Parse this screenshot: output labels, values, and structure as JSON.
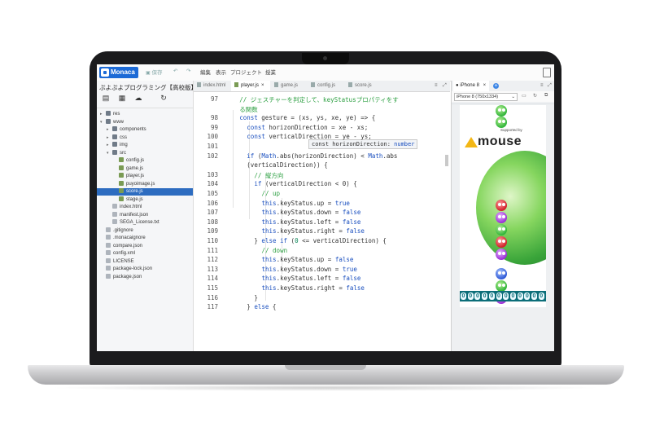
{
  "app": {
    "name": "Monaca",
    "brand_color": "#1c6ad6"
  },
  "toolbar": {
    "save": "保存",
    "undo_icon": "undo-icon",
    "redo_icon": "redo-icon",
    "menu": [
      "編集",
      "表示",
      "プロジェクト",
      "授業"
    ]
  },
  "project": {
    "title": "ぷよぷよプログラミング【高校版】..."
  },
  "file_tree": [
    {
      "label": "res",
      "type": "folder",
      "depth": 0,
      "expanded": false
    },
    {
      "label": "www",
      "type": "folder",
      "depth": 0,
      "expanded": true
    },
    {
      "label": "components",
      "type": "folder",
      "depth": 1,
      "expanded": false
    },
    {
      "label": "css",
      "type": "folder",
      "depth": 1,
      "expanded": false
    },
    {
      "label": "img",
      "type": "folder",
      "depth": 1,
      "expanded": false
    },
    {
      "label": "src",
      "type": "folder",
      "depth": 1,
      "expanded": true
    },
    {
      "label": "config.js",
      "type": "js",
      "depth": 2
    },
    {
      "label": "game.js",
      "type": "js",
      "depth": 2
    },
    {
      "label": "player.js",
      "type": "js",
      "depth": 2
    },
    {
      "label": "puyoimage.js",
      "type": "js",
      "depth": 2
    },
    {
      "label": "score.js",
      "type": "js",
      "depth": 2,
      "selected": true
    },
    {
      "label": "stage.js",
      "type": "js",
      "depth": 2
    },
    {
      "label": "index.html",
      "type": "file",
      "depth": 1
    },
    {
      "label": "manifest.json",
      "type": "file",
      "depth": 1
    },
    {
      "label": "SEGA_License.txt",
      "type": "file",
      "depth": 1
    },
    {
      "label": ".gitignore",
      "type": "file",
      "depth": 0
    },
    {
      "label": ".monacaignore",
      "type": "file",
      "depth": 0
    },
    {
      "label": "compare.json",
      "type": "file",
      "depth": 0
    },
    {
      "label": "config.xml",
      "type": "file",
      "depth": 0
    },
    {
      "label": "LICENSE",
      "type": "file",
      "depth": 0
    },
    {
      "label": "package-lock.json",
      "type": "file",
      "depth": 0
    },
    {
      "label": "package.json",
      "type": "file",
      "depth": 0
    }
  ],
  "editor_tabs": [
    {
      "label": "index.html",
      "active": false
    },
    {
      "label": "player.js",
      "active": true
    },
    {
      "label": "game.js",
      "active": false
    },
    {
      "label": "config.js",
      "active": false
    },
    {
      "label": "score.js",
      "active": false
    }
  ],
  "code": {
    "line_numbers": [
      "97",
      "",
      "98",
      "99",
      "100",
      "101",
      "102",
      "",
      "103",
      "104",
      "105",
      "106",
      "107",
      "108",
      "109",
      "110",
      "111",
      "112",
      "113",
      "114",
      "115",
      "116",
      "117"
    ],
    "lines": [
      "// ジェスチャーを判定して、keyStatusプロパティをす",
      "る関数",
      "const gesture = (xs, ys, xe, ye) => {",
      "const horizonDirection = xe - xs;",
      "const verticalDirection = ye - ys;",
      "",
      "if (Math.abs(horizonDirection) < Math.abs",
      "(verticalDirection)) {",
      "// 縦方向",
      "if (verticalDirection < 0) {",
      "// up",
      "this.keyStatus.up = true",
      "this.keyStatus.down = false",
      "this.keyStatus.left = false",
      "this.keyStatus.right = false",
      "} else if (0 <= verticalDirection) {",
      "// down",
      "this.keyStatus.up = false",
      "this.keyStatus.down = true",
      "this.keyStatus.left = false",
      "this.keyStatus.right = false",
      "}",
      "} else {"
    ],
    "tooltip": {
      "name": "const horizonDirection:",
      "type": "number"
    }
  },
  "preview": {
    "tab_label": "iPhone 8",
    "device_select": "iPhone 8 (750x1334)",
    "sponsor_caption": "Supported by",
    "sponsor_name": "mouse",
    "score_digits": "000000000000"
  },
  "colors": {
    "selection": "#2d6cc0",
    "comment": "#2ea043",
    "keyword": "#1a4fbf",
    "score_bar": "#0c6e79"
  }
}
